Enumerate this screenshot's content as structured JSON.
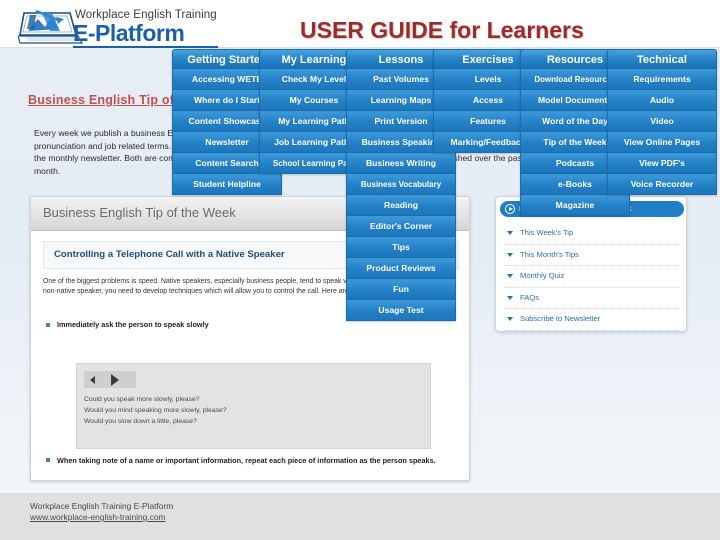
{
  "slide": {
    "title": "USER GUIDE for Learners",
    "title_color": "#9e2a2a",
    "accent_blue": "#1f7ec4",
    "background": "#e8eef5"
  },
  "logo": {
    "line1": "Workplace English Training",
    "line2": "E-Platform",
    "icon": "laptop-chart-icon"
  },
  "section": {
    "heading": "Business English Tip of the Week",
    "paragraph": "Every week we publish a business English topic area, including common business expressions, grammar, vocabulary, pronunciation and job related terms. Tips are emailed to you if you subscribe to our newsletter. You can choose either the weekly or the monthly newsletter. Both are completely free! In addition, we publish a monthly quiz based on the tips published over the past month."
  },
  "screenshot": {
    "header_title": "Business English Tip of the Week",
    "sub_title": "Controlling a Telephone Call with a Native Speaker",
    "body": "One of the biggest problems is speed. Native speakers, especially business people, tend to speak very quickly on the telephone. As a non-native speaker, you need to develop techniques which will allow you to control the call. Here are some practical tips:",
    "bullet1": "Immediately ask the person to speak slowly",
    "audio": {
      "prev_label": "previous-audio",
      "play_label": "play-audio",
      "lines": [
        "Could you speak more slowly, please?",
        "Would you mind speaking more slowly, please?",
        "Would you slow down a little, please?"
      ]
    },
    "bullet2": "When taking note of a name or important information, repeat each piece of information as the person speaks."
  },
  "resources_panel": {
    "pill_label": "Business English Tip of the Week",
    "items": [
      "This Week's Tip",
      "This Month's Tips",
      "Monthly Quiz",
      "FAQs",
      "Subscribe to Newsletter"
    ]
  },
  "menus": [
    {
      "id": "getting-started",
      "header": "Getting Started",
      "items": [
        "Accessing WETE",
        "Where do I Start",
        "Content Showcase",
        "Newsletter",
        "Content Search",
        "Student Helpline"
      ]
    },
    {
      "id": "my-learning",
      "header": "My Learning",
      "items": [
        "Check My Level",
        "My Courses",
        "My Learning Path",
        "Job Learning Paths",
        "School Learning Path"
      ]
    },
    {
      "id": "lessons",
      "header": "Lessons",
      "items": [
        "Past Volumes",
        "Learning Maps",
        "Print Version",
        "Business Speaking",
        "Business Writing",
        "Business Vocabulary",
        "Reading",
        "Editor's Corner",
        "Tips",
        "Product Reviews",
        "Fun",
        "Usage Test"
      ]
    },
    {
      "id": "exercises",
      "header": "Exercises",
      "items": [
        "Levels",
        "Access",
        "Features",
        "Marking/Feedback"
      ]
    },
    {
      "id": "resources",
      "header": "Resources",
      "items": [
        "Download Resources",
        "Model Documents",
        "Word of the Day",
        "Tip of the Week",
        "Podcasts",
        "e-Books",
        "Magazine"
      ]
    },
    {
      "id": "technical",
      "header": "Technical",
      "items": [
        "Requirements",
        "Audio",
        "Video",
        "View Online Pages",
        "View PDF's",
        "Voice Recorder"
      ]
    }
  ],
  "footer": {
    "line1": "Workplace English Training E-Platform",
    "line2": "www.workplace-english-training.com"
  }
}
